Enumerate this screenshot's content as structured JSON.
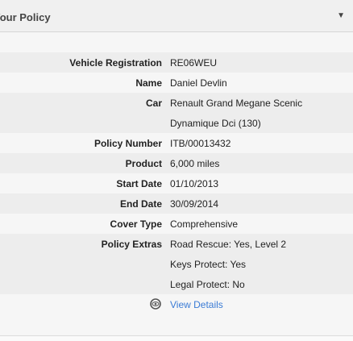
{
  "header": {
    "title": "Your Policy",
    "toggle": "▼"
  },
  "policy": {
    "vehicle_registration_label": "Vehicle Registration",
    "vehicle_registration": "RE06WEU",
    "name_label": "Name",
    "name": "Daniel Devlin",
    "car_label": "Car",
    "car_line1": "Renault Grand Megane Scenic",
    "car_line2": "Dynamique Dci (130)",
    "policy_number_label": "Policy Number",
    "policy_number": "ITB/00013432",
    "product_label": "Product",
    "product": "6,000 miles",
    "start_date_label": "Start Date",
    "start_date": "01/10/2013",
    "end_date_label": "End Date",
    "end_date": "30/09/2014",
    "cover_type_label": "Cover Type",
    "cover_type": "Comprehensive",
    "policy_extras_label": "Policy Extras",
    "extras": [
      "Road Rescue: Yes, Level 2",
      "Keys Protect: Yes",
      "Legal Protect: No"
    ],
    "view_details": "View Details"
  }
}
